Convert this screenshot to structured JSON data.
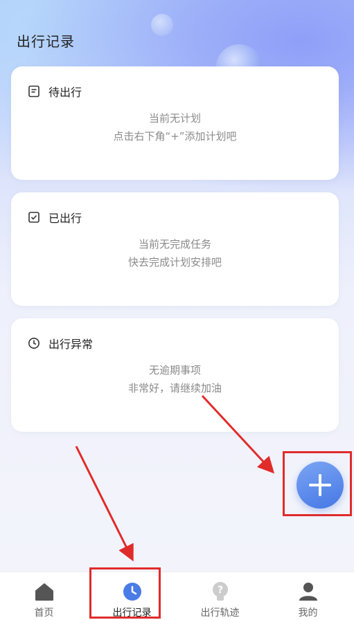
{
  "header": {
    "title": "出行记录"
  },
  "cards": [
    {
      "title": "待出行",
      "icon": "document-icon",
      "lines": [
        "当前无计划",
        "点击右下角“+”添加计划吧"
      ]
    },
    {
      "title": "已出行",
      "icon": "checkbox-icon",
      "lines": [
        "当前无完成任务",
        "快去完成计划安排吧"
      ]
    },
    {
      "title": "出行异常",
      "icon": "clock-icon",
      "lines": [
        "无逾期事项",
        "非常好，请继续加油"
      ]
    }
  ],
  "fab": {
    "icon": "plus-icon"
  },
  "tabbar": {
    "items": [
      {
        "label": "首页",
        "icon": "home-icon"
      },
      {
        "label": "出行记录",
        "icon": "clock-icon",
        "active": true
      },
      {
        "label": "出行轨迹",
        "icon": "question-bulb-icon"
      },
      {
        "label": "我的",
        "icon": "user-icon"
      }
    ]
  },
  "colors": {
    "accent": "#4a7be6",
    "annotation": "#e02b2b",
    "muted_text": "#8a8a8a"
  }
}
